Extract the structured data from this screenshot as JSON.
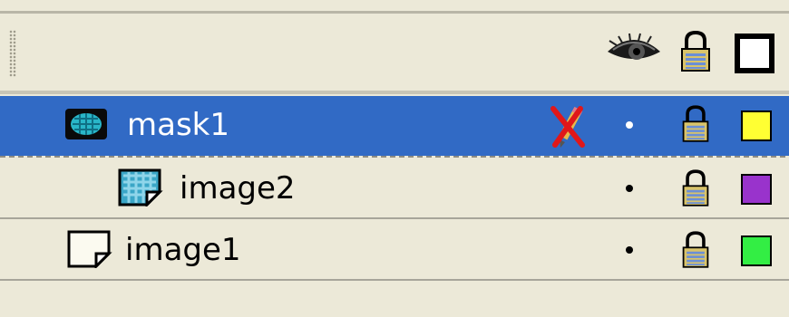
{
  "panel": {
    "header": {
      "grip_icon": "drag-grip-icon",
      "eye_icon": "eye-icon",
      "lock_icon": "lock-icon",
      "outline_icon": "outline-square-icon"
    },
    "layers": [
      {
        "name": "mask1",
        "type": "mask",
        "icon": "mask-layer-icon",
        "selected": true,
        "status_icon": "pencil-crossed-icon",
        "visible_dot": true,
        "locked": true,
        "outline_color": "#ffff33"
      },
      {
        "name": "image2",
        "type": "masked",
        "icon": "masked-layer-icon",
        "selected": false,
        "visible_dot": true,
        "locked": true,
        "outline_color": "#9933cc"
      },
      {
        "name": "image1",
        "type": "normal",
        "icon": "normal-layer-icon",
        "selected": false,
        "visible_dot": true,
        "locked": true,
        "outline_color": "#33ee44"
      }
    ]
  },
  "colors": {
    "panel_bg": "#ece9d8",
    "selection": "#316ac5"
  }
}
